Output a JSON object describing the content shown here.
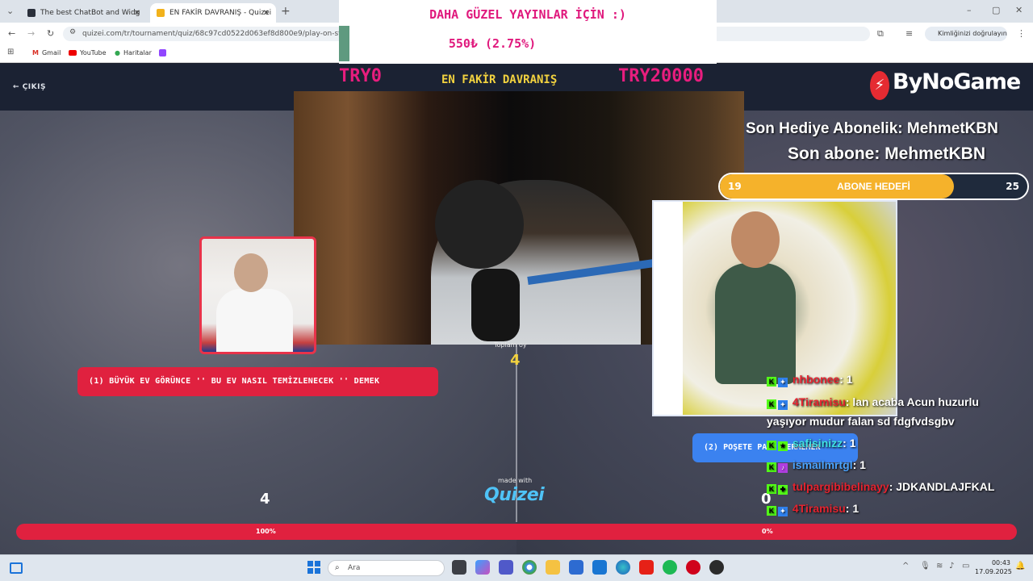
{
  "browser": {
    "tabs": [
      {
        "label": "The best ChatBot and Widg",
        "active": false
      },
      {
        "label": "EN FAKİR DAVRANIŞ - Quizei",
        "active": true
      }
    ],
    "url": "quizei.com/tr/tournament/quiz/68c97cd0522d063ef8d800e9/play-on-stream",
    "verify_label": "Kimliğinizi doğrulayın",
    "bookmarks": [
      "Gmail",
      "YouTube",
      "Haritalar"
    ]
  },
  "overlay": {
    "banner_top": "DAHA GÜZEL YAYINLAR İÇİN :)",
    "banner_amount": "550₺ (2.75%)",
    "try_left": "TRY0",
    "try_right": "TRY20000",
    "sub_gift": "Son Hediye Abonelik: MehmetKBN",
    "last_sub": "Son abone: MehmetKBN",
    "goal": {
      "label": "ABONE HEDEFİ",
      "current": "19",
      "target": "25",
      "fraction": 0.76
    },
    "brand": "ByNoGame"
  },
  "quiz": {
    "exit_label": "ÇIKIŞ",
    "title": "EN FAKİR DAVRANIŞ",
    "total_label": "Toplam oy",
    "total_value": "4",
    "option1": "(1) BÜYÜK EV GÖRÜNCE '' BU EV NASIL TEMİZLENECEK '' DEMEK",
    "option2": "(2) POŞETE PARA VERMEMEK",
    "count_left": "4",
    "count_right": "0",
    "made_with": "made with",
    "quizei_logo": "Quizei",
    "pct_left": "100%",
    "pct_right": "0%"
  },
  "chat": [
    {
      "user": "nhbonee",
      "text": ": 1",
      "color": "#e5232f"
    },
    {
      "user": "4Tiramisu",
      "text": ": lan acaba Acun huzurlu",
      "color": "#e5232f"
    },
    {
      "user": "",
      "text": "yaşıyor mudur falan sd fdgfvdsgbv",
      "color": "#ffffff"
    },
    {
      "user": "safisinizz",
      "text": ": 1",
      "color": "#3fe0e0"
    },
    {
      "user": "ismailmrtgl",
      "text": ": 1",
      "color": "#4aa3ff"
    },
    {
      "user": "tulpargibibelinayy",
      "text": ": JDKANDLAJFKAL",
      "color": "#e5232f"
    },
    {
      "user": "4Tiramisu",
      "text": ": 1",
      "color": "#e5232f"
    }
  ],
  "taskbar": {
    "search_placeholder": "Ara",
    "time": "00:43",
    "date": "17.09.2025"
  },
  "icons": [
    "back-icon",
    "forward-icon",
    "reload-icon",
    "zoom-icon",
    "star-icon",
    "extensions-icon",
    "apps-icon",
    "windows-start-icon",
    "search-icon"
  ]
}
